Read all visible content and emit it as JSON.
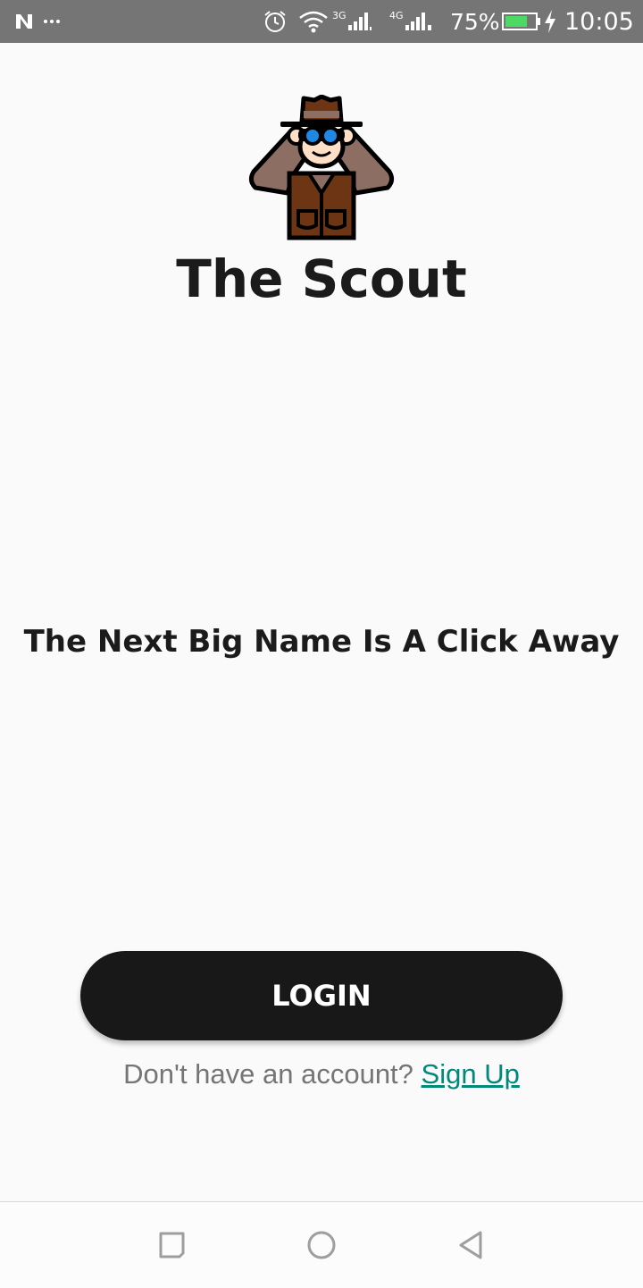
{
  "status_bar": {
    "notification_icons": [
      "n-icon",
      "more-dots-icon"
    ],
    "system_icons": [
      "alarm-icon",
      "wifi-icon",
      "signal-3g-icon",
      "signal-4g-icon",
      "battery-icon",
      "charging-icon"
    ],
    "sim1_label": "3G",
    "sim2_label": "4G",
    "battery": "75%",
    "time": "10:05",
    "colors": {
      "background": "#757575",
      "battery_fill": "#4cd964"
    }
  },
  "app": {
    "logo_icon": "scout-binoculars-icon",
    "title": "The Scout",
    "tagline": "The Next Big Name Is A Click Away"
  },
  "actions": {
    "login_label": "LOGIN",
    "signup_prompt": "Don't have an account?",
    "signup_link": "Sign Up"
  },
  "colors": {
    "page_background": "#fafafa",
    "button_background": "#191819",
    "link": "#00897b",
    "muted_text": "#757575"
  },
  "nav_bar": {
    "buttons": [
      "recents-icon",
      "home-icon",
      "back-icon"
    ]
  }
}
